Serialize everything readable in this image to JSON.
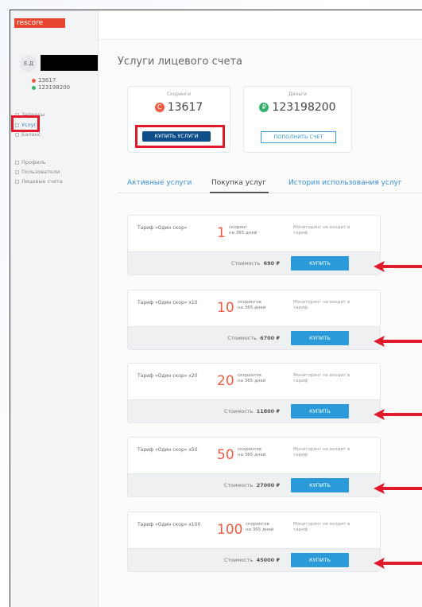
{
  "logo": "rescore",
  "user": {
    "initials": "Е.Д",
    "scores_balance": "13617",
    "money_balance": "123198200"
  },
  "nav": [
    {
      "label": "Запросы"
    },
    {
      "label": "Услуги"
    },
    {
      "label": "Баланс"
    },
    {
      "label": "Профиль"
    },
    {
      "label": "Пользователи"
    },
    {
      "label": "Лицевые счета"
    }
  ],
  "page_title": "Услуги лицевого счета",
  "cards": {
    "scores": {
      "label": "Скоринги",
      "value": "13617",
      "coin": "С",
      "button": "КУПИТЬ УСЛУГИ"
    },
    "money": {
      "label": "Деньги",
      "value": "123198200",
      "coin": "₽",
      "button": "ПОПОЛНИТЬ СЧЕТ"
    }
  },
  "tabs": [
    {
      "label": "Активные услуги"
    },
    {
      "label": "Покупка услуг"
    },
    {
      "label": "История использования услуг"
    }
  ],
  "tariffs": [
    {
      "name": "Тариф «Один скор»",
      "count": "1",
      "unit1": "скоринг",
      "unit2": "на 365 дней",
      "note": "Мониторинг не входит в тариф",
      "price_label": "Стоимость",
      "price": "690 ₽",
      "button": "КУПИТЬ"
    },
    {
      "name": "Тариф «Один скор» x10",
      "count": "10",
      "unit1": "скорингов",
      "unit2": "на 365 дней",
      "note": "Мониторинг не входит в тариф",
      "price_label": "Стоимость",
      "price": "6700 ₽",
      "button": "КУПИТЬ"
    },
    {
      "name": "Тариф «Один скор» x20",
      "count": "20",
      "unit1": "скорингов",
      "unit2": "на 365 дней",
      "note": "Мониторинг не входит в тариф",
      "price_label": "Стоимость",
      "price": "11800 ₽",
      "button": "КУПИТЬ"
    },
    {
      "name": "Тариф «Один скор» x50",
      "count": "50",
      "unit1": "скорингов",
      "unit2": "на 365 дней",
      "note": "Мониторинг не входит в тариф",
      "price_label": "Стоимость",
      "price": "27000 ₽",
      "button": "КУПИТЬ"
    },
    {
      "name": "Тариф «Один скор» x100",
      "count": "100",
      "unit1": "скорингов",
      "unit2": "на 365 дней",
      "note": "Мониторинг не входит в тариф",
      "price_label": "Стоимость",
      "price": "45000 ₽",
      "button": "КУПИТЬ"
    }
  ],
  "colors": {
    "accent": "#ef5a44",
    "brand": "#e8452f",
    "button": "#2a9ad8",
    "highlight": "#e01a2b"
  }
}
